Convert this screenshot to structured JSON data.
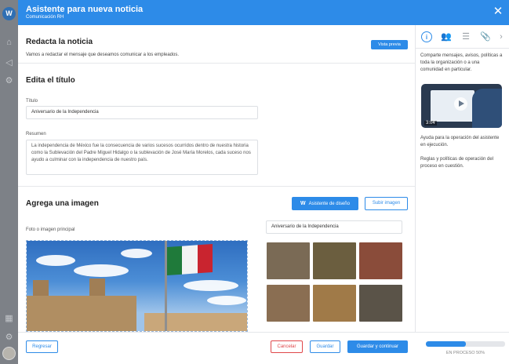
{
  "header": {
    "title": "Asistente para nueva noticia",
    "subtitle": "Comunicación RH"
  },
  "compose": {
    "title": "Redacta la noticia",
    "description": "Vamos a redactar el mensaje que deseamos comunicar a los empleados.",
    "preview_label": "Vista previa"
  },
  "edit_title": {
    "heading": "Edita el título",
    "title_label": "Título",
    "title_value": "Aniversario de la Independencia",
    "summary_label": "Resumen",
    "summary_value": "La independencia de México fue la consecuencia de varios sucesos ocurridos dentro de nuestra historia como la Sublevación del Padre Miguel Hidalgo o la sublevación de José María Morelos, cada suceso nos ayudo a culminar con la independencia de nuestro país."
  },
  "image_section": {
    "heading": "Agrega una imagen",
    "design_assistant_label": "Asistente de diseño",
    "upload_label": "Subir imagen",
    "main_image_label": "Foto o imagen principal",
    "search_value": "Aniversario de la Independencia",
    "thumbnails": [
      {
        "color": "#7a6a55"
      },
      {
        "color": "#6b5e3f"
      },
      {
        "color": "#8a4c3a"
      },
      {
        "color": "#8a6e52"
      },
      {
        "color": "#a07a48"
      },
      {
        "color": "#5a5348"
      }
    ]
  },
  "side_panel": {
    "text1": "Comparte mensajes, avisos, políticas a toda la organización o a una comunidad en particular.",
    "video_duration": "3:04",
    "text2": "Ayuda para la operación del asistente en ejecución.",
    "text3": "Reglas y políticas de operación del proceso en cuestión."
  },
  "footer": {
    "back_label": "Regresar",
    "cancel_label": "Cancelar",
    "save_label": "Guardar",
    "save_continue_label": "Guardar y continuar",
    "progress_label": "EN PROCESO 50%",
    "progress_value": 0.5
  },
  "colors": {
    "accent": "#2d8be8",
    "danger": "#e0474a"
  }
}
